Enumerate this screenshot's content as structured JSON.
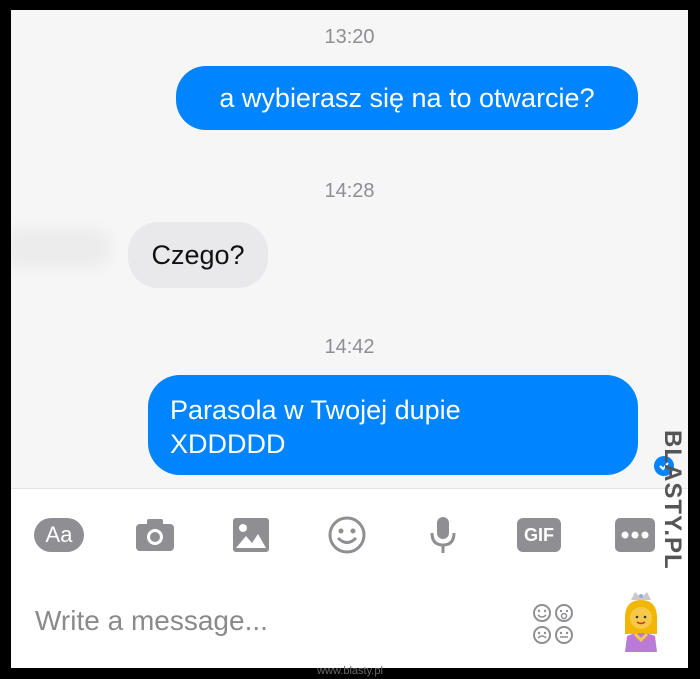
{
  "messages": [
    {
      "timestamp": "13:20",
      "text": "a wybierasz się na to otwarcie?"
    },
    {
      "timestamp": "14:28",
      "text": "Czego?"
    },
    {
      "timestamp": "14:42",
      "line1": "Parasola w Twojej dupie",
      "line2": "XDDDDD"
    }
  ],
  "toolbar": {
    "aa_label": "Aa",
    "gif_label": "GIF"
  },
  "composer": {
    "placeholder": "Write a message..."
  },
  "watermark": {
    "text": "BLASTY.PL",
    "url": "www.blasty.pl"
  },
  "colors": {
    "accent": "#0084ff",
    "incoming": "#e9e9eb",
    "icon": "#8e8e93"
  },
  "icons": [
    "camera-icon",
    "image-icon",
    "smiley-icon",
    "microphone-icon",
    "more-icon",
    "sticker-grid-icon",
    "princess-emoji-icon",
    "seen-check-icon"
  ]
}
